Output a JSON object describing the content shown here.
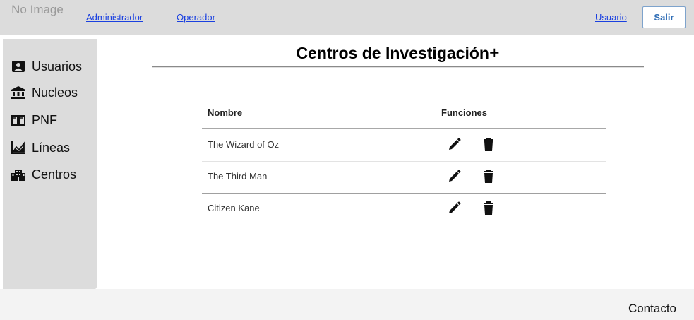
{
  "header": {
    "logo_text": "No Image",
    "nav": [
      "Administrador",
      "Operador"
    ],
    "user_link": "Usuario",
    "logout_label": "Salir"
  },
  "sidebar": {
    "items": [
      {
        "label": "Usuarios",
        "icon": "user-card-icon"
      },
      {
        "label": "Nucleos",
        "icon": "institution-icon"
      },
      {
        "label": "PNF",
        "icon": "open-book-icon"
      },
      {
        "label": "Líneas",
        "icon": "area-chart-icon"
      },
      {
        "label": "Centros",
        "icon": "building-icon"
      }
    ]
  },
  "main": {
    "title": "Centros de Investigación",
    "add_symbol": "+",
    "table": {
      "headers": [
        "Nombre",
        "Funciones"
      ],
      "rows": [
        {
          "name": "The Wizard of Oz"
        },
        {
          "name": "The Third Man"
        },
        {
          "name": "Citizen Kane"
        }
      ]
    }
  },
  "footer": {
    "contact": "Contacto"
  }
}
